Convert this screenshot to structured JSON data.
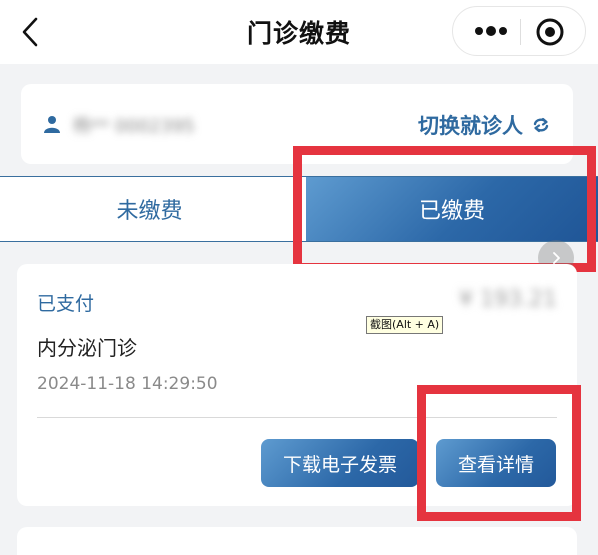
{
  "header": {
    "title": "门诊缴费",
    "back_icon": "chevron-left-icon",
    "more_icon": "more-dots-icon",
    "close_icon": "target-circle-icon"
  },
  "patient": {
    "info_masked": "杨** 0002395",
    "switch_label": "切换就诊人",
    "refresh_icon": "refresh-icon"
  },
  "tabs": [
    {
      "label": "未缴费",
      "active": false
    },
    {
      "label": "已缴费",
      "active": true
    }
  ],
  "payment": {
    "status": "已支付",
    "amount": "¥ 193.21",
    "department": "内分泌门诊",
    "time": "2024-11-18 14:29:50",
    "invoice_button": "下载电子发票",
    "detail_button": "查看详情"
  },
  "tooltip": "截图(Alt + A)",
  "colors": {
    "accent": "#2f6aa0",
    "highlight": "#e5343f"
  }
}
